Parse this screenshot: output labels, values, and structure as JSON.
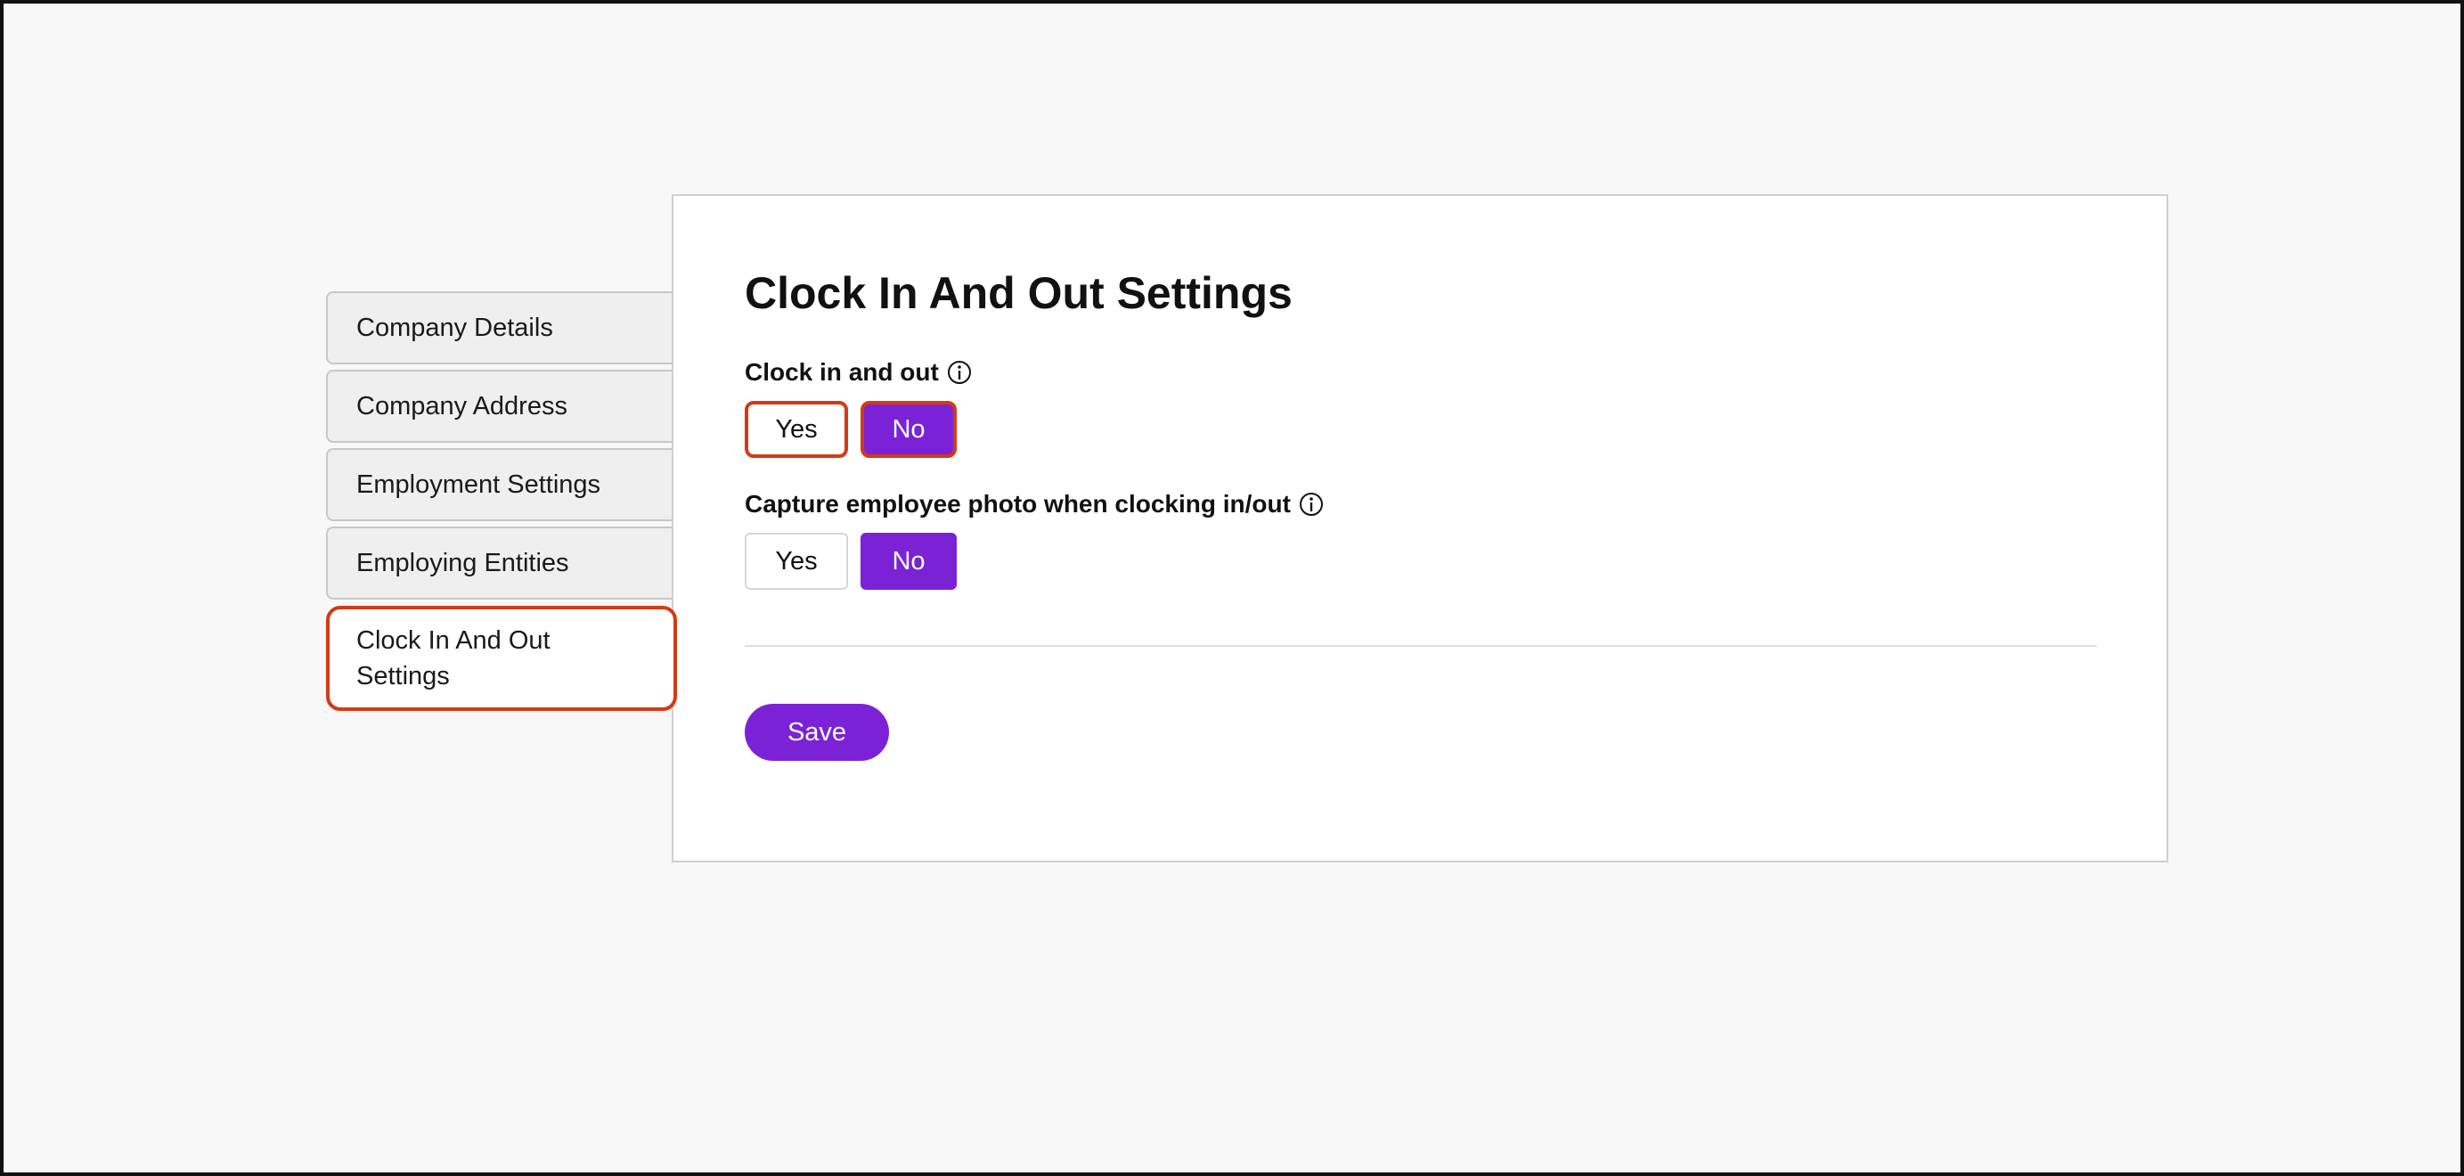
{
  "sidebar": {
    "items": [
      {
        "label": "Company Details"
      },
      {
        "label": "Company Address"
      },
      {
        "label": "Employment Settings"
      },
      {
        "label": "Employing Entities"
      },
      {
        "label": "Clock In And Out Settings",
        "active": true
      }
    ]
  },
  "main": {
    "title": "Clock In And Out Settings",
    "fields": [
      {
        "label": "Clock in and out",
        "icon": "info-icon",
        "yes_label": "Yes",
        "no_label": "No",
        "selected": "No"
      },
      {
        "label": "Capture employee photo when clocking in/out",
        "icon": "info-icon",
        "yes_label": "Yes",
        "no_label": "No",
        "selected": "No"
      }
    ],
    "save_label": "Save"
  },
  "colors": {
    "accent": "#7b22d6",
    "highlight": "#d43a14",
    "background": "#f8f8f8"
  }
}
